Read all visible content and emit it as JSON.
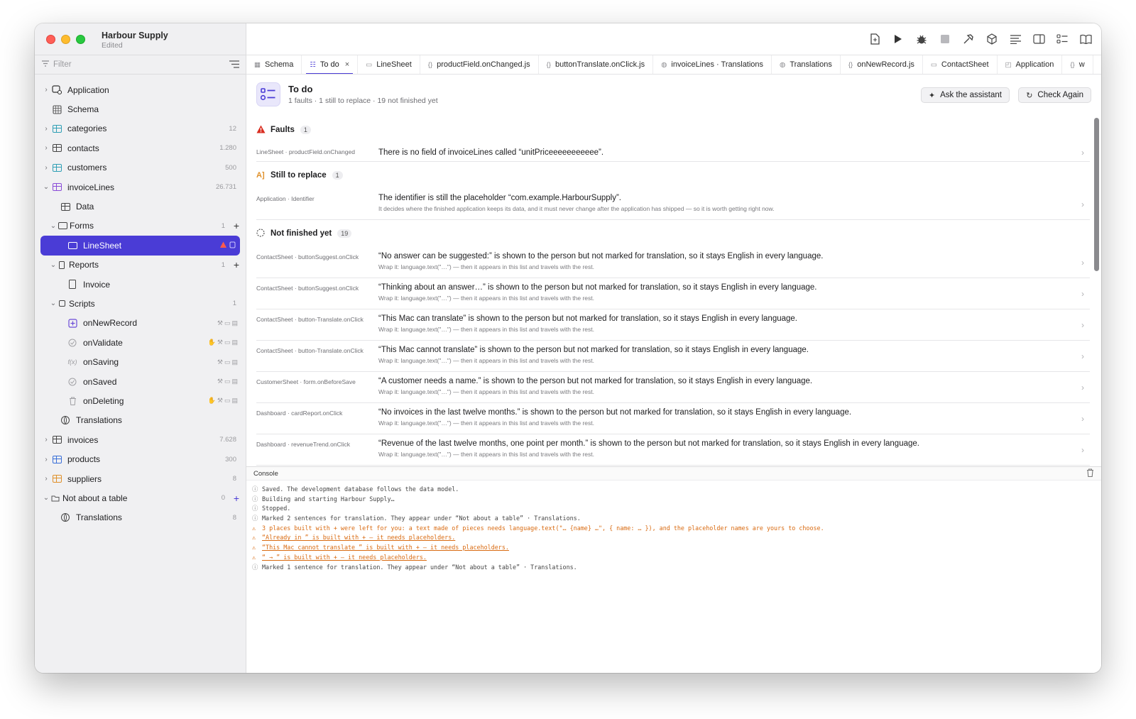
{
  "app": {
    "name": "Harbour Supply",
    "status": "Edited"
  },
  "sidebar": {
    "filter_placeholder": "Filter",
    "items": [
      {
        "label": "Application",
        "count": "",
        "icon": "application-icon"
      },
      {
        "label": "Schema",
        "count": "",
        "icon": "schema-icon"
      },
      {
        "label": "categories",
        "count": "12",
        "icon": "table-icon"
      },
      {
        "label": "contacts",
        "count": "1.280",
        "icon": "table-icon"
      },
      {
        "label": "customers",
        "count": "500",
        "icon": "table-icon"
      },
      {
        "label": "invoiceLines",
        "count": "26.731",
        "icon": "table-icon"
      },
      {
        "label": "Data",
        "count": "",
        "icon": "data-icon"
      },
      {
        "label": "Forms",
        "count": "1",
        "icon": "forms-icon"
      },
      {
        "label": "LineSheet",
        "count": "",
        "icon": "form-icon"
      },
      {
        "label": "Reports",
        "count": "1",
        "icon": "reports-icon"
      },
      {
        "label": "Invoice",
        "count": "",
        "icon": "report-icon"
      },
      {
        "label": "Scripts",
        "count": "1",
        "icon": "scripts-icon"
      },
      {
        "label": "onNewRecord",
        "count": "",
        "icon": "new-record-icon"
      },
      {
        "label": "onValidate",
        "count": "",
        "icon": "validate-icon"
      },
      {
        "label": "onSaving",
        "count": "",
        "icon": "function-icon"
      },
      {
        "label": "onSaved",
        "count": "",
        "icon": "saved-icon"
      },
      {
        "label": "onDeleting",
        "count": "",
        "icon": "trash-icon"
      },
      {
        "label": "Translations",
        "count": "",
        "icon": "globe-icon"
      },
      {
        "label": "invoices",
        "count": "7.628",
        "icon": "table-icon"
      },
      {
        "label": "products",
        "count": "300",
        "icon": "table-icon"
      },
      {
        "label": "suppliers",
        "count": "8",
        "icon": "table-icon"
      },
      {
        "label": "Not about a table",
        "count": "0",
        "icon": "folder-icon"
      },
      {
        "label": "Translations",
        "count": "8",
        "icon": "globe-icon"
      }
    ]
  },
  "tabs": [
    {
      "label": "Schema",
      "icon": "schema-icon"
    },
    {
      "label": "To do",
      "icon": "checklist-icon"
    },
    {
      "label": "LineSheet",
      "icon": "form-icon"
    },
    {
      "label": "productField.onChanged.js",
      "icon": "script-icon"
    },
    {
      "label": "buttonTranslate.onClick.js",
      "icon": "script-icon"
    },
    {
      "label": "invoiceLines · Translations",
      "icon": "globe-icon"
    },
    {
      "label": "Translations",
      "icon": "globe-icon"
    },
    {
      "label": "onNewRecord.js",
      "icon": "script-icon"
    },
    {
      "label": "ContactSheet",
      "icon": "form-icon"
    },
    {
      "label": "Application",
      "icon": "application-icon"
    },
    {
      "label": "w",
      "icon": "script-icon"
    }
  ],
  "todo": {
    "title": "To do",
    "summary": "1 faults · 1 still to replace · 19 not finished yet",
    "ask_label": "Ask the assistant",
    "check_label": "Check Again"
  },
  "sections": {
    "faults": {
      "title": "Faults",
      "count": "1",
      "items": [
        {
          "loc": "LineSheet · productField.onChanged",
          "msg": "There is no field of invoiceLines called “unitPriceeeeeeeeeee”."
        }
      ]
    },
    "replace": {
      "title": "Still to replace",
      "count": "1",
      "items": [
        {
          "loc": "Application · Identifier",
          "msg": "The identifier is still the placeholder “com.example.HarbourSupply”.",
          "hint": "It decides where the finished application keeps its data, and it must never change after the application has shipped — so it is worth getting right now."
        }
      ]
    },
    "unfinished": {
      "title": "Not finished yet",
      "count": "19",
      "items": [
        {
          "loc": "ContactSheet · buttonSuggest.onClick",
          "msg": "“No answer can be suggested:” is shown to the person but not marked for translation, so it stays English in every language.",
          "hint": "Wrap it: language.text(\"…\") — then it appears in this list and travels with the rest."
        },
        {
          "loc": "ContactSheet · buttonSuggest.onClick",
          "msg": "“Thinking about an answer…” is shown to the person but not marked for translation, so it stays English in every language.",
          "hint": "Wrap it: language.text(\"…\") — then it appears in this list and travels with the rest."
        },
        {
          "loc": "ContactSheet · button-Translate.onClick",
          "msg": "“This Mac can translate” is shown to the person but not marked for translation, so it stays English in every language.",
          "hint": "Wrap it: language.text(\"…\") — then it appears in this list and travels with the rest."
        },
        {
          "loc": "ContactSheet · button-Translate.onClick",
          "msg": "“This Mac cannot translate” is shown to the person but not marked for translation, so it stays English in every language.",
          "hint": "Wrap it: language.text(\"…\") — then it appears in this list and travels with the rest."
        },
        {
          "loc": "CustomerSheet · form.onBeforeSave",
          "msg": "“A customer needs a name.” is shown to the person but not marked for translation, so it stays English in every language.",
          "hint": "Wrap it: language.text(\"…\") — then it appears in this list and travels with the rest."
        },
        {
          "loc": "Dashboard · cardReport.onClick",
          "msg": "“No invoices in the last twelve months.” is shown to the person but not marked for translation, so it stays English in every language.",
          "hint": "Wrap it: language.text(\"…\") — then it appears in this list and travels with the rest."
        },
        {
          "loc": "Dashboard · revenueTrend.onClick",
          "msg": "“Revenue of the last twelve months, one point per month.” is shown to the person but not marked for translation, so it stays English in every language.",
          "hint": "Wrap it: language.text(\"…\") — then it appears in this list and travels with the rest."
        }
      ]
    }
  },
  "console": {
    "title": "Console",
    "lines": [
      {
        "kind": "info",
        "text": "Saved. The development database follows the data model."
      },
      {
        "kind": "info",
        "text": "Building and starting Harbour Supply…"
      },
      {
        "kind": "info",
        "text": "Stopped."
      },
      {
        "kind": "info",
        "text": "Marked 2 sentences for translation. They appear under “Not about a table” · Translations."
      },
      {
        "kind": "warn",
        "text": "3 places built with + were left for you: a text made of pieces needs language.text(\"… {name} …\", { name: … }), and the placeholder names are yours to choose."
      },
      {
        "kind": "link",
        "text": "“Already in ” is built with + — it needs placeholders."
      },
      {
        "kind": "link",
        "text": "“This Mac cannot translate ” is built with + — it needs placeholders."
      },
      {
        "kind": "link",
        "text": "“ → ” is built with + — it needs placeholders."
      },
      {
        "kind": "info",
        "text": "Marked 1 sentence for translation. They appear under “Not about a table” · Translations."
      }
    ]
  },
  "colors": {
    "accent": "#4a3cd6",
    "warning": "#d96a10",
    "fault": "#d92d20",
    "table_icon": "#2f9fb5",
    "table_icon_selected": "#6b4bd8",
    "suppliers_icon": "#e0902a"
  }
}
